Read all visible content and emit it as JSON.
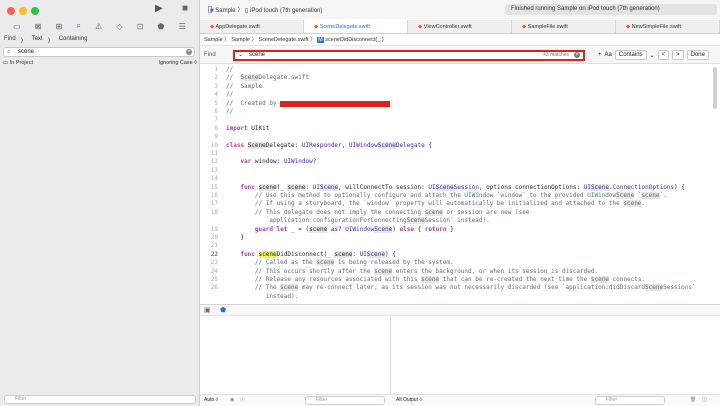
{
  "toolbar": {
    "scheme": "Sample",
    "separator": "〉",
    "device": "iPod touch (7th generation)",
    "status": "Finished running Sample on iPod touch (7th generation)",
    "run_icon": "play-icon",
    "stop_icon": "stop-icon"
  },
  "sidebar": {
    "find_label": "Find",
    "find_mode": "Text",
    "find_match": "Containing",
    "query": "scene",
    "scope": "In Project",
    "case": "Ignoring Case ◊",
    "filter_placeholder": "Filter"
  },
  "tabs": [
    {
      "label": "AppDelegate.swift"
    },
    {
      "label": "SceneDelegate.swift"
    },
    {
      "label": "ViewController.swift"
    },
    {
      "label": "SampleFile.swift"
    },
    {
      "label": "NewSimpleFile.swift"
    }
  ],
  "jumpbar": {
    "crumb1": "Sample",
    "crumb2": "Sample",
    "crumb3": "SceneDelegate.swift",
    "crumb4": "sceneDidDisconnect(_:)"
  },
  "findbar": {
    "label": "Find",
    "query": "scene",
    "matches": "43 matches",
    "aa": "Aa",
    "mode": "Contains",
    "prev": "<",
    "next": ">",
    "done": "Done"
  },
  "code": [
    {
      "n": "1",
      "t": "//"
    },
    {
      "n": "2",
      "t": "//  SceneDelegate.swift"
    },
    {
      "n": "3",
      "t": "//  Sample"
    },
    {
      "n": "4",
      "t": "//"
    },
    {
      "n": "5",
      "t": "//  Created by"
    },
    {
      "n": "6",
      "t": "//"
    },
    {
      "n": "7",
      "t": ""
    },
    {
      "n": "8",
      "t": "import UIKit"
    },
    {
      "n": "9",
      "t": ""
    },
    {
      "n": "10",
      "t": "class SceneDelegate: UIResponder, UIWindowSceneDelegate {"
    },
    {
      "n": "11",
      "t": ""
    },
    {
      "n": "12",
      "t": "    var window: UIWindow?"
    },
    {
      "n": "13",
      "t": ""
    },
    {
      "n": "14",
      "t": ""
    },
    {
      "n": "15",
      "t": "    func scene(_ scene: UIScene, willConnectTo session: UISceneSession, options connectionOptions: UIScene.ConnectionOptions) {"
    },
    {
      "n": "16",
      "t": "        // Use this method to optionally configure and attach the UIWindow `window` to the provided UIWindowScene `scene`."
    },
    {
      "n": "17",
      "t": "        // If using a storyboard, the `window` property will automatically be initialized and attached to the scene."
    },
    {
      "n": "18",
      "t": "        // This delegate does not imply the connecting scene or session are new (see"
    },
    {
      "n": "",
      "t": "           `application:configurationForConnectingSceneSession` instead)."
    },
    {
      "n": "19",
      "t": "        guard let _ = (scene as? UIWindowScene) else { return }"
    },
    {
      "n": "20",
      "t": "    }"
    },
    {
      "n": "21",
      "t": ""
    },
    {
      "n": "22",
      "t": "    func sceneDidDisconnect(_ scene: UIScene) {"
    },
    {
      "n": "23",
      "t": "        // Called as the scene is being released by the system."
    },
    {
      "n": "24",
      "t": "        // This occurs shortly after the scene enters the background, or when its session is discarded."
    },
    {
      "n": "25",
      "t": "        // Release any resources associated with this scene that can be re-created the next time the scene connects."
    },
    {
      "n": "26",
      "t": "        // The scene may re-connect later, as its session was not necessarily discarded (see `application:didDiscardSceneSessions`"
    },
    {
      "n": "",
      "t": "           instead)."
    }
  ],
  "bottom": {
    "auto": "Auto ◊",
    "filter_placeholder": "Filter",
    "output": "All Output ◊"
  },
  "colors": {
    "red": "#e0201b",
    "accent": "#2a6fdb",
    "keyword": "#ad3da4",
    "type": "#4b21b0",
    "comment": "#5d6c79",
    "highlight": "#f7f14d"
  }
}
